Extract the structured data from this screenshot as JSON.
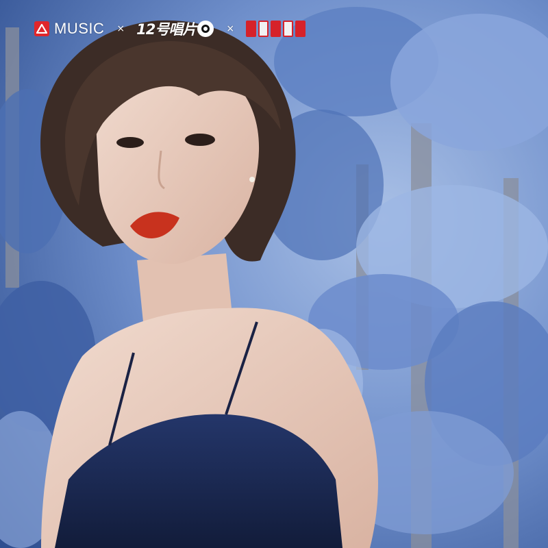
{
  "header": {
    "brand": {
      "icon": "red-triangle-logo-icon",
      "name": "MUSIC"
    },
    "separator": "×",
    "label": {
      "text": "12号唱片",
      "icon": "vinyl-disc-icon"
    },
    "separator2": "×",
    "partner": {
      "text": "音乐合伙人",
      "icon": "red-seal-stamp-icon"
    }
  },
  "colors": {
    "foliage": "#7f9fd4",
    "foliage_dark": "#2d4e8e",
    "dress": "#1b2a52",
    "skin": "#e9cdbf",
    "hair": "#3c2c26",
    "lips": "#c8321e",
    "brand_red": "#e0262b"
  }
}
